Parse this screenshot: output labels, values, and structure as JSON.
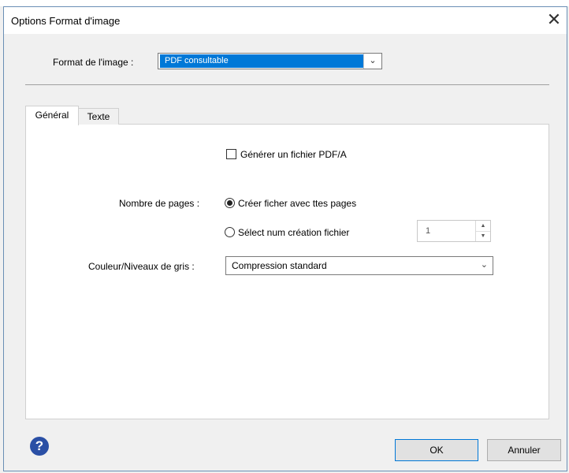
{
  "window": {
    "title": "Options Format d'image",
    "close_glyph": "✕"
  },
  "format": {
    "label": "Format de l'image :",
    "selected": "PDF consultable"
  },
  "tabs": [
    {
      "label": "Général",
      "active": true
    },
    {
      "label": "Texte",
      "active": false
    }
  ],
  "general": {
    "pdfa_label": "Générer un fichier PDF/A",
    "pdfa_checked": false,
    "pages_label": "Nombre de pages :",
    "radio_all_label": "Créer ficher avec ttes pages",
    "radio_select_label": "Sélect num création fichier",
    "pages_count": "1",
    "color_label": "Couleur/Niveaux de gris :",
    "color_selected": "Compression standard"
  },
  "footer": {
    "help_glyph": "?",
    "ok_label": "OK",
    "cancel_label": "Annuler"
  },
  "icons": [
    "close-icon",
    "chevron-down-icon",
    "help-icon",
    "spin-up-icon",
    "spin-down-icon"
  ],
  "colors": {
    "accent": "#0078d7",
    "help": "#2a4fa5"
  }
}
